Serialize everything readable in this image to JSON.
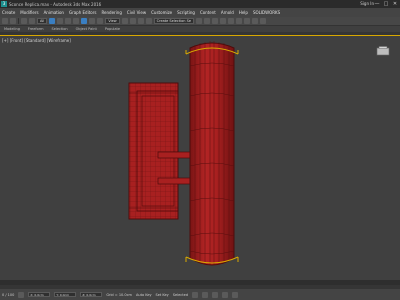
{
  "window": {
    "title": "Sconce Replica.max - Autodesk 3ds Max 2016",
    "sign_in": "Sign In",
    "minimize": "—",
    "maximize": "□",
    "close": "✕"
  },
  "menubar": {
    "items": [
      "Create",
      "Modifiers",
      "Animation",
      "Graph Editors",
      "Rendering",
      "Civil View",
      "Customize",
      "Scripting",
      "Content",
      "Arnold",
      "Help",
      "SOLIDWORKS"
    ]
  },
  "toolbar": {
    "selection_filter": "All",
    "view_dropdown": "View",
    "named_selection": "Create Selection Se"
  },
  "ribbon": {
    "tabs": [
      "Modeling",
      "Freeform",
      "Selection",
      "Object Paint",
      "Populate"
    ]
  },
  "viewport": {
    "label": "[+] [Front] [Standard] [Wireframe]"
  },
  "statusbar": {
    "frame_readout": "0 / 100",
    "grid_readout": "Grid = 10.0cm",
    "coord_x": "X: 0.0cm",
    "coord_y": "Y: 0.0cm",
    "coord_z": "Z: 0.0cm",
    "auto_key": "Auto Key",
    "set_key": "Set Key",
    "selected": "Selected"
  },
  "colors": {
    "accent": "#d8a800",
    "mesh_fill": "#a82020",
    "mesh_edge": "#5a0e0e",
    "viewport_bg": "#404040",
    "ui_panel": "#444444"
  }
}
